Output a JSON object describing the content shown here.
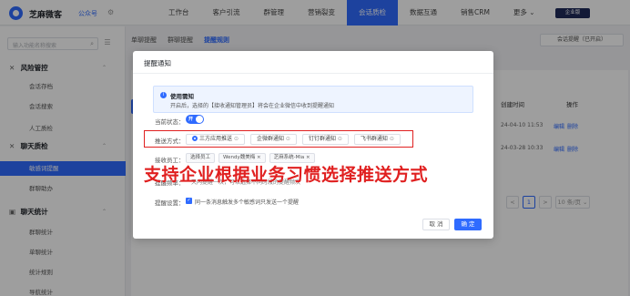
{
  "topbar": {
    "brand": "芝麻微客",
    "brand_sub": "公众号",
    "nav": [
      "工作台",
      "客户引流",
      "群管理",
      "营销裂变",
      "会话质检",
      "数据互通",
      "销售CRM",
      "更多 ⌄"
    ],
    "active_nav_index": 4,
    "enterprise_badge": "企业版"
  },
  "sidebar": {
    "search_placeholder": "输入功能名称搜索",
    "groups": [
      {
        "label": "风险管控",
        "icon": "shield-icon",
        "items": [
          "会话存档",
          "会话搜索",
          "人工质检"
        ]
      },
      {
        "label": "聊天质检",
        "icon": "chat-check-icon",
        "items": [
          "敏感词提醒",
          "群聊助办"
        ]
      },
      {
        "label": "聊天统计",
        "icon": "stats-icon",
        "items": [
          "群聊统计",
          "单聊统计",
          "统计规则",
          "导航统计"
        ]
      }
    ],
    "active_item": "敏感词提醒"
  },
  "main": {
    "sub_tabs": [
      "单聊提醒",
      "群聊提醒",
      "提醒规则"
    ],
    "active_sub_tab": 2,
    "session_remind": "会话提醒（已开启）",
    "table": {
      "headers": [
        "创建时间",
        "操作"
      ],
      "rows": [
        {
          "time": "24-04-10 11:53",
          "actions": [
            "编辑",
            "删除"
          ]
        },
        {
          "time": "24-03-28 10:33",
          "actions": [
            "编辑",
            "删除"
          ]
        }
      ]
    },
    "pager": {
      "prev": "<",
      "current": "1",
      "next": ">",
      "page_size": "10 条/页 ⌄"
    }
  },
  "modal": {
    "title": "提醒通知",
    "notice_title": "使用需知",
    "notice_text": "开启后，选择的【接收通知管理员】将会在企业微信中收到提醒通知",
    "status_label": "当前状态：",
    "toggle_text": "开",
    "push_label": "推送方式：",
    "push_options": [
      {
        "label": "三方应用推送",
        "selected": true
      },
      {
        "label": "企微群通知",
        "selected": false
      },
      {
        "label": "钉钉群通知",
        "selected": false
      },
      {
        "label": "飞书群通知",
        "selected": false
      }
    ],
    "receiver_label": "接收员工：",
    "receiver_chips": [
      "选择员工",
      "Wendy魏美梅 ×",
      "芝麻系统-Mia ×"
    ],
    "freq_label": "提醒频率：",
    "freq_text": "一天内提醒一次，可以选择不同时段的提醒频次",
    "settings_label": "提醒设置：",
    "settings_text": "同一条消息触发多个敏感词只发送一个提醒",
    "cancel_label": "取 消",
    "ok_label": "确 定",
    "promo_text": "支持企业根据业务习惯选择推送方式"
  },
  "colors": {
    "accent": "#2f6bff",
    "highlight": "#e02020"
  }
}
